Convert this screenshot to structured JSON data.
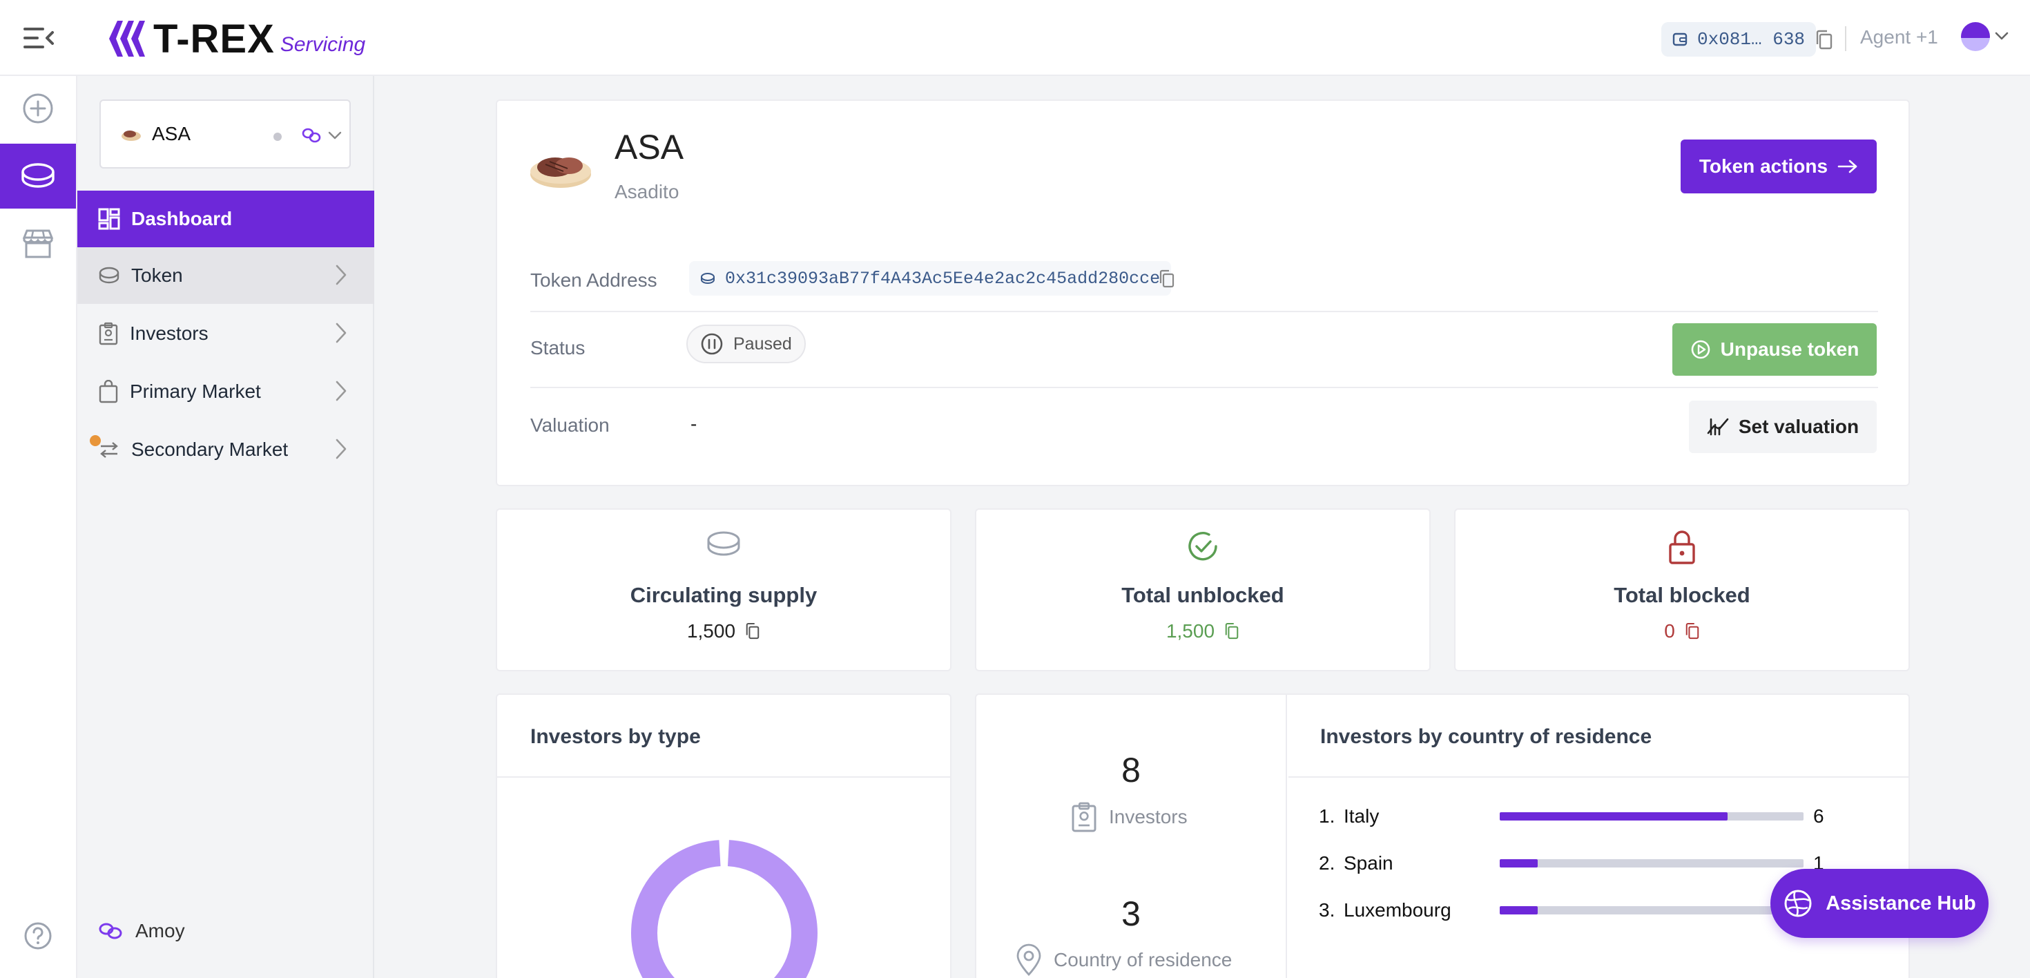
{
  "header": {
    "brand_name": "T-REX",
    "brand_sub": "Servicing",
    "wallet": "0x081… 638",
    "agent": "Agent +1"
  },
  "sidebar": {
    "token_selector": {
      "name": "ASA"
    },
    "items": [
      {
        "label": "Dashboard"
      },
      {
        "label": "Token"
      },
      {
        "label": "Investors"
      },
      {
        "label": "Primary Market"
      },
      {
        "label": "Secondary Market"
      }
    ],
    "network": "Amoy"
  },
  "token": {
    "symbol": "ASA",
    "name": "Asadito",
    "actions_label": "Token actions",
    "address_label": "Token Address",
    "address": "0x31c39093aB77f4A43Ac5Ee4e2ac2c45add280cce",
    "status_label": "Status",
    "status": "Paused",
    "unpause_label": "Unpause token",
    "valuation_label": "Valuation",
    "valuation": "-",
    "set_valuation_label": "Set valuation"
  },
  "stats": [
    {
      "title": "Circulating supply",
      "value": "1,500",
      "color": "#222222"
    },
    {
      "title": "Total unblocked",
      "value": "1,500",
      "color": "#5a9e52"
    },
    {
      "title": "Total blocked",
      "value": "0",
      "color": "#b03a3a"
    }
  ],
  "investors_by_type": {
    "title": "Investors by type"
  },
  "summary": {
    "investors_count": "8",
    "investors_label": "Investors",
    "countries_count": "3",
    "countries_label": "Country of residence"
  },
  "by_country": {
    "title": "Investors by country of residence",
    "rows": [
      {
        "rank": "1.",
        "name": "Italy",
        "count": "6",
        "fraction": 0.75
      },
      {
        "rank": "2.",
        "name": "Spain",
        "count": "1",
        "fraction": 0.125
      },
      {
        "rank": "3.",
        "name": "Luxembourg",
        "count": "",
        "fraction": 0.125
      }
    ]
  },
  "assistance": {
    "label": "Assistance Hub"
  },
  "colors": {
    "brand": "#6d28d9",
    "success": "#7cbd74",
    "danger": "#b03a3a"
  }
}
